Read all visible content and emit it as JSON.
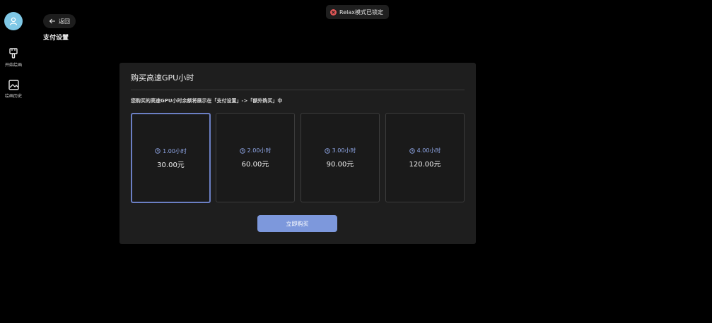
{
  "sidebar": {
    "items": [
      {
        "label": "开始绘画",
        "icon": "brush-icon"
      },
      {
        "label": "绘画历史",
        "icon": "image-icon"
      }
    ]
  },
  "header": {
    "back_label": "返回",
    "page_title": "支付设置"
  },
  "status": {
    "text": "Relax模式已锁定",
    "color": "#e05656"
  },
  "panel": {
    "title": "购买高速GPU小时",
    "note": "您购买的高速GPU小时余额将展示在「支付设置」->「额外购买」中",
    "options": [
      {
        "hours": "1.00小时",
        "price": "30.00元",
        "selected": true
      },
      {
        "hours": "2.00小时",
        "price": "60.00元",
        "selected": false
      },
      {
        "hours": "3.00小时",
        "price": "90.00元",
        "selected": false
      },
      {
        "hours": "4.00小时",
        "price": "120.00元",
        "selected": false
      }
    ],
    "buy_label": "立即购买"
  },
  "colors": {
    "accent": "#7d98dc",
    "selected_border": "#6b7fc4",
    "hours_text": "#8fa6e6"
  }
}
